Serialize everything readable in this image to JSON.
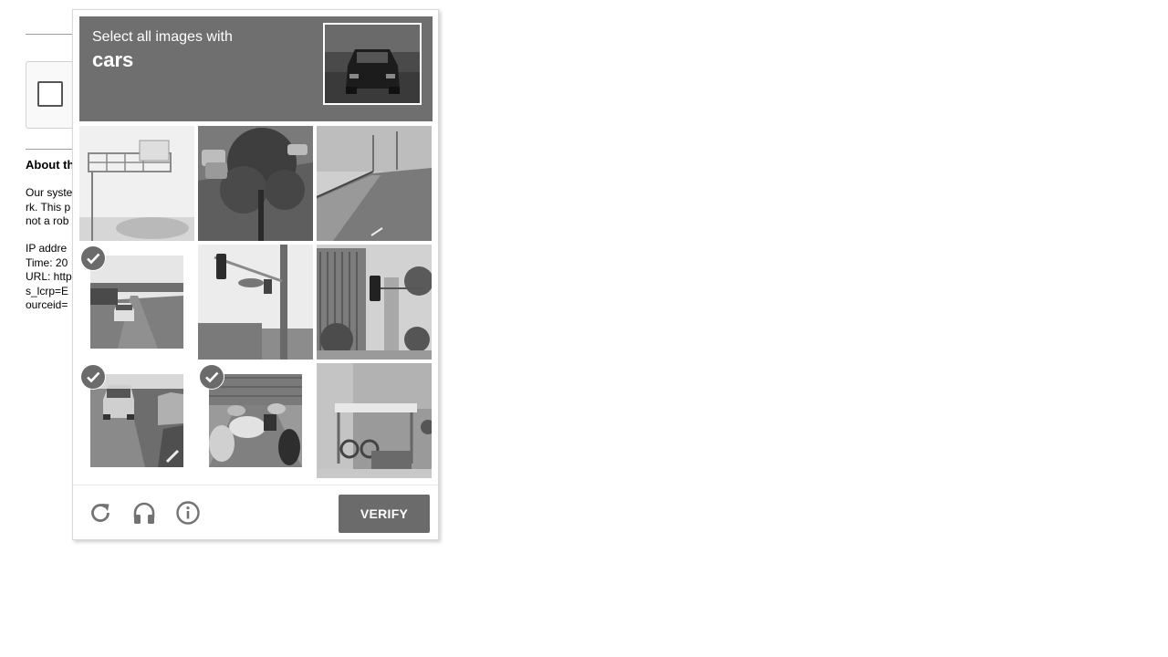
{
  "page": {
    "about_title": "About th",
    "paragraph1": [
      "Our syste",
      "rk. This p",
      "not a rob"
    ],
    "paragraph2": [
      "IP addre",
      "Time: 20",
      "URL: http",
      "s_lcrp=E",
      "ourceid="
    ]
  },
  "challenge": {
    "prompt": "Select all images with",
    "keyword": "cars",
    "tiles": [
      {
        "name": "highway-sign",
        "selected": false
      },
      {
        "name": "tree-road",
        "selected": false
      },
      {
        "name": "overpass-road",
        "selected": false
      },
      {
        "name": "highway-car",
        "selected": true
      },
      {
        "name": "traffic-light",
        "selected": false
      },
      {
        "name": "buildings-traffic-light",
        "selected": false
      },
      {
        "name": "cars-road",
        "selected": true
      },
      {
        "name": "city-traffic",
        "selected": true
      },
      {
        "name": "bus-stop",
        "selected": false
      }
    ],
    "footer": {
      "reload_icon": "reload-icon",
      "audio_icon": "headphones-icon",
      "info_icon": "info-icon",
      "verify_label": "VERIFY"
    }
  },
  "colors": {
    "header_bg": "#6f6f6f",
    "button_bg": "#6b6b6b",
    "icon_gray": "#737373"
  }
}
